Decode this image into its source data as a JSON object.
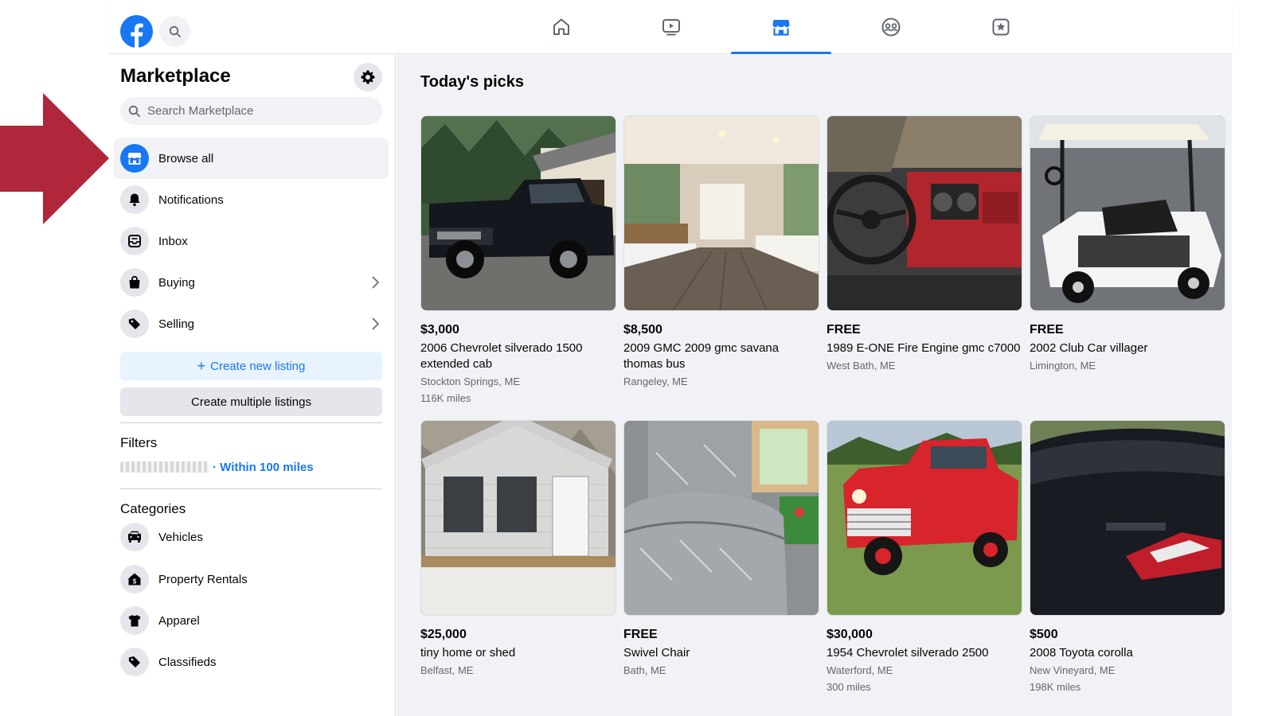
{
  "nav": {
    "tabs": [
      {
        "name": "home"
      },
      {
        "name": "watch"
      },
      {
        "name": "marketplace",
        "active": true
      },
      {
        "name": "groups"
      },
      {
        "name": "gaming"
      }
    ],
    "accent": "#1877f2"
  },
  "sidebar": {
    "title": "Marketplace",
    "search_placeholder": "Search Marketplace",
    "items": [
      {
        "label": "Browse all",
        "icon": "storefront-icon",
        "active": true
      },
      {
        "label": "Notifications",
        "icon": "bell-icon"
      },
      {
        "label": "Inbox",
        "icon": "inbox-icon"
      },
      {
        "label": "Buying",
        "icon": "shopping-bag-icon",
        "has_submenu": true
      },
      {
        "label": "Selling",
        "icon": "price-tag-icon",
        "has_submenu": true
      }
    ],
    "create_listing": "Create new listing",
    "create_multiple": "Create multiple listings",
    "filters_heading": "Filters",
    "radius": "· Within 100 miles",
    "categories_heading": "Categories",
    "categories": [
      {
        "label": "Vehicles",
        "icon": "car-icon"
      },
      {
        "label": "Property Rentals",
        "icon": "house-dollar-icon"
      },
      {
        "label": "Apparel",
        "icon": "shirt-icon"
      },
      {
        "label": "Classifieds",
        "icon": "tag-icon"
      }
    ]
  },
  "main": {
    "title": "Today's picks",
    "listings": [
      {
        "price": "$3,000",
        "title": "2006 Chevrolet silverado 1500 extended cab",
        "location": "Stockton Springs, ME",
        "miles": "116K miles"
      },
      {
        "price": "$8,500",
        "title": "2009 GMC 2009 gmc savana thomas bus",
        "location": "Rangeley, ME",
        "miles": ""
      },
      {
        "price": "FREE",
        "title": "1989 E-ONE Fire Engine gmc c7000",
        "location": "West Bath, ME",
        "miles": ""
      },
      {
        "price": "FREE",
        "title": "2002 Club Car villager",
        "location": "Limington, ME",
        "miles": ""
      },
      {
        "price": "$25,000",
        "title": "tiny home or shed",
        "location": "Belfast, ME",
        "miles": ""
      },
      {
        "price": "FREE",
        "title": "Swivel Chair",
        "location": "Bath, ME",
        "miles": ""
      },
      {
        "price": "$30,000",
        "title": "1954 Chevrolet silverado 2500",
        "location": "Waterford, ME",
        "miles": "300 miles"
      },
      {
        "price": "$500",
        "title": "2008 Toyota corolla",
        "location": "New Vineyard, ME",
        "miles": "198K miles"
      }
    ]
  },
  "annotation": {
    "arrow_color": "#b0263a"
  }
}
